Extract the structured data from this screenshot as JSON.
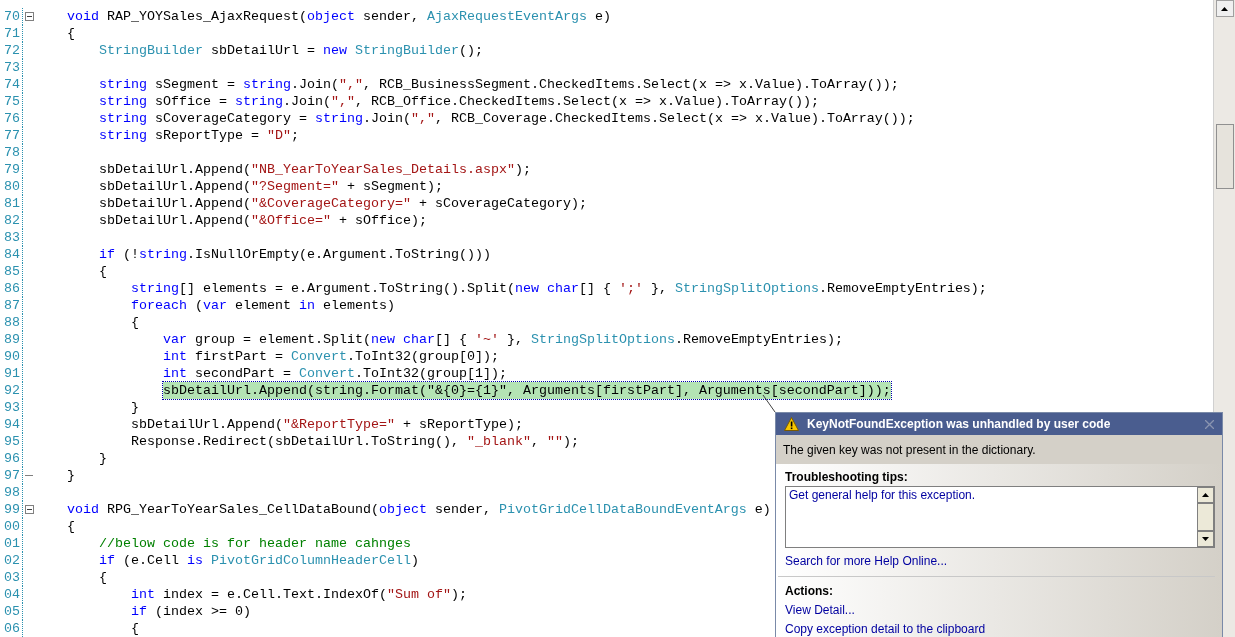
{
  "editor": {
    "lines": [
      {
        "number": "70",
        "kind": "fold_start",
        "selected": false,
        "tokens": [
          {
            "kind": "keyword",
            "text": "void"
          },
          {
            "kind": "plain",
            "text": " RAP_YOYSales_AjaxRequest("
          },
          {
            "kind": "keyword",
            "text": "object"
          },
          {
            "kind": "plain",
            "text": " sender, "
          },
          {
            "kind": "type",
            "text": "AjaxRequestEventArgs"
          },
          {
            "kind": "plain",
            "text": " e)"
          }
        ]
      },
      {
        "number": "71",
        "kind": "code",
        "selected": false,
        "tokens": [
          {
            "kind": "plain",
            "text": "{"
          }
        ]
      },
      {
        "number": "72",
        "kind": "code",
        "selected": false,
        "tokens": [
          {
            "kind": "type",
            "text": "StringBuilder"
          },
          {
            "kind": "plain",
            "text": " sbDetailUrl = "
          },
          {
            "kind": "keyword",
            "text": "new"
          },
          {
            "kind": "type",
            "text": " StringBuilder"
          },
          {
            "kind": "plain",
            "text": "();"
          }
        ]
      },
      {
        "number": "73",
        "kind": "code",
        "selected": false
      },
      {
        "number": "74",
        "kind": "code",
        "selected": false,
        "tokens": [
          {
            "kind": "keyword",
            "text": "string"
          },
          {
            "kind": "plain",
            "text": " sSegment = "
          },
          {
            "kind": "keyword",
            "text": "string"
          },
          {
            "kind": "plain",
            "text": ".Join("
          },
          {
            "kind": "string",
            "text": "\",\""
          },
          {
            "kind": "plain",
            "text": ", RCB_BusinessSegment.CheckedItems.Select(x => x.Value).ToArray());"
          }
        ]
      },
      {
        "number": "75",
        "kind": "code",
        "selected": false,
        "tokens": [
          {
            "kind": "keyword",
            "text": "string"
          },
          {
            "kind": "plain",
            "text": " sOffice = "
          },
          {
            "kind": "keyword",
            "text": "string"
          },
          {
            "kind": "plain",
            "text": ".Join("
          },
          {
            "kind": "string",
            "text": "\",\""
          },
          {
            "kind": "plain",
            "text": ", RCB_Office.CheckedItems.Select(x => x.Value).ToArray());"
          }
        ]
      },
      {
        "number": "76",
        "kind": "code",
        "selected": false,
        "tokens": [
          {
            "kind": "keyword",
            "text": "string"
          },
          {
            "kind": "plain",
            "text": " sCoverageCategory = "
          },
          {
            "kind": "keyword",
            "text": "string"
          },
          {
            "kind": "plain",
            "text": ".Join("
          },
          {
            "kind": "string",
            "text": "\",\""
          },
          {
            "kind": "plain",
            "text": ", RCB_Coverage.CheckedItems.Select(x => x.Value).ToArray());"
          }
        ]
      },
      {
        "number": "77",
        "kind": "code",
        "selected": false,
        "tokens": [
          {
            "kind": "keyword",
            "text": "string"
          },
          {
            "kind": "plain",
            "text": " sReportType = "
          },
          {
            "kind": "string",
            "text": "\"D\""
          },
          {
            "kind": "plain",
            "text": ";"
          }
        ]
      },
      {
        "number": "78",
        "kind": "code",
        "selected": false
      },
      {
        "number": "79",
        "kind": "code",
        "selected": false,
        "tokens": [
          {
            "kind": "plain",
            "text": "sbDetailUrl.Append("
          },
          {
            "kind": "string",
            "text": "\"NB_YearToYearSales_Details.aspx\""
          },
          {
            "kind": "plain",
            "text": ");"
          }
        ]
      },
      {
        "number": "80",
        "kind": "code",
        "selected": false,
        "tokens": [
          {
            "kind": "plain",
            "text": "sbDetailUrl.Append("
          },
          {
            "kind": "string",
            "text": "\"?Segment=\""
          },
          {
            "kind": "plain",
            "text": " + sSegment);"
          }
        ]
      },
      {
        "number": "81",
        "kind": "code",
        "selected": false,
        "tokens": [
          {
            "kind": "plain",
            "text": "sbDetailUrl.Append("
          },
          {
            "kind": "string",
            "text": "\"&CoverageCategory=\""
          },
          {
            "kind": "plain",
            "text": " + sCoverageCategory);"
          }
        ]
      },
      {
        "number": "82",
        "kind": "code",
        "selected": false,
        "tokens": [
          {
            "kind": "plain",
            "text": "sbDetailUrl.Append("
          },
          {
            "kind": "string",
            "text": "\"&Office=\""
          },
          {
            "kind": "plain",
            "text": " + sOffice);"
          }
        ]
      },
      {
        "number": "83",
        "kind": "code",
        "selected": false
      },
      {
        "number": "84",
        "kind": "code",
        "selected": false,
        "tokens": [
          {
            "kind": "keyword",
            "text": "if"
          },
          {
            "kind": "plain",
            "text": " (!"
          },
          {
            "kind": "keyword",
            "text": "string"
          },
          {
            "kind": "plain",
            "text": ".IsNullOrEmpty(e.Argument.ToString()))"
          }
        ]
      },
      {
        "number": "85",
        "kind": "code",
        "selected": false,
        "tokens": [
          {
            "kind": "plain",
            "text": "{"
          }
        ]
      },
      {
        "number": "86",
        "kind": "code",
        "selected": false,
        "tokens": [
          {
            "kind": "keyword",
            "text": "string"
          },
          {
            "kind": "plain",
            "text": "[] elements = e.Argument.ToString().Split("
          },
          {
            "kind": "keyword",
            "text": "new char"
          },
          {
            "kind": "plain",
            "text": "[] { "
          },
          {
            "kind": "string",
            "text": "';'"
          },
          {
            "kind": "plain",
            "text": " }, "
          },
          {
            "kind": "type",
            "text": "StringSplitOptions"
          },
          {
            "kind": "plain",
            "text": ".RemoveEmptyEntries);"
          }
        ]
      },
      {
        "number": "87",
        "kind": "code",
        "selected": false,
        "tokens": [
          {
            "kind": "keyword",
            "text": "foreach"
          },
          {
            "kind": "plain",
            "text": " ("
          },
          {
            "kind": "keyword",
            "text": "var"
          },
          {
            "kind": "plain",
            "text": " element "
          },
          {
            "kind": "keyword",
            "text": "in"
          },
          {
            "kind": "plain",
            "text": " elements)"
          }
        ]
      },
      {
        "number": "88",
        "kind": "code",
        "selected": false,
        "tokens": [
          {
            "kind": "plain",
            "text": "{"
          }
        ]
      },
      {
        "number": "89",
        "kind": "code",
        "selected": false,
        "tokens": [
          {
            "kind": "keyword",
            "text": "var"
          },
          {
            "kind": "plain",
            "text": " group = element.Split("
          },
          {
            "kind": "keyword",
            "text": "new char"
          },
          {
            "kind": "plain",
            "text": "[] { "
          },
          {
            "kind": "string",
            "text": "'~'"
          },
          {
            "kind": "plain",
            "text": " }, "
          },
          {
            "kind": "type",
            "text": "StringSplitOptions"
          },
          {
            "kind": "plain",
            "text": ".RemoveEmptyEntries);"
          }
        ]
      },
      {
        "number": "90",
        "kind": "code",
        "selected": false,
        "tokens": [
          {
            "kind": "keyword",
            "text": "int"
          },
          {
            "kind": "plain",
            "text": " firstPart = "
          },
          {
            "kind": "type",
            "text": "Convert"
          },
          {
            "kind": "plain",
            "text": ".ToInt32(group[0]);"
          }
        ]
      },
      {
        "number": "91",
        "kind": "code",
        "selected": false,
        "tokens": [
          {
            "kind": "keyword",
            "text": "int"
          },
          {
            "kind": "plain",
            "text": " secondPart = "
          },
          {
            "kind": "type",
            "text": "Convert"
          },
          {
            "kind": "plain",
            "text": ".ToInt32(group[1]);"
          }
        ]
      },
      {
        "number": "92",
        "kind": "code",
        "selected": true,
        "tokens": [
          {
            "kind": "plain",
            "text": "sbDetailUrl.Append(string.Format(\"&{0}={1}\", Arguments[firstPart], Arguments[secondPart]));"
          }
        ]
      },
      {
        "number": "93",
        "kind": "code",
        "selected": false,
        "tokens": [
          {
            "kind": "plain",
            "text": "}"
          }
        ]
      },
      {
        "number": "94",
        "kind": "code",
        "selected": false,
        "tokens": [
          {
            "kind": "plain",
            "text": "sbDetailUrl.Append("
          },
          {
            "kind": "string",
            "text": "\"&ReportType=\""
          },
          {
            "kind": "plain",
            "text": " + sReportType);"
          }
        ]
      },
      {
        "number": "95",
        "kind": "code",
        "selected": false,
        "tokens": [
          {
            "kind": "plain",
            "text": "Response.Redirect(sbDetailUrl.ToString(), "
          },
          {
            "kind": "string",
            "text": "\"_blank\""
          },
          {
            "kind": "plain",
            "text": ", "
          },
          {
            "kind": "string",
            "text": "\"\""
          },
          {
            "kind": "plain",
            "text": ");"
          }
        ]
      },
      {
        "number": "96",
        "kind": "code",
        "selected": false,
        "tokens": [
          {
            "kind": "plain",
            "text": "}"
          }
        ]
      },
      {
        "number": "97",
        "kind": "fold_end",
        "selected": false,
        "tokens": [
          {
            "kind": "plain",
            "text": "}"
          }
        ]
      },
      {
        "number": "98",
        "kind": "code",
        "selected": false
      },
      {
        "number": "99",
        "kind": "fold_start",
        "selected": false,
        "tokens": [
          {
            "kind": "keyword",
            "text": "void"
          },
          {
            "kind": "plain",
            "text": " RPG_YearToYearSales_CellDataBound("
          },
          {
            "kind": "keyword",
            "text": "object"
          },
          {
            "kind": "plain",
            "text": " sender, "
          },
          {
            "kind": "type",
            "text": "PivotGridCellDataBoundEventArgs"
          },
          {
            "kind": "plain",
            "text": " e)"
          }
        ]
      },
      {
        "number": "00",
        "kind": "code",
        "selected": false,
        "tokens": [
          {
            "kind": "plain",
            "text": "{"
          }
        ]
      },
      {
        "number": "01",
        "kind": "code",
        "selected": false,
        "tokens": [
          {
            "kind": "comment",
            "text": "//below code is for header name cahnges"
          }
        ]
      },
      {
        "number": "02",
        "kind": "code",
        "selected": false,
        "tokens": [
          {
            "kind": "keyword",
            "text": "if"
          },
          {
            "kind": "plain",
            "text": " (e.Cell "
          },
          {
            "kind": "keyword",
            "text": "is"
          },
          {
            "kind": "type",
            "text": " PivotGridColumnHeaderCell"
          },
          {
            "kind": "plain",
            "text": ")"
          }
        ]
      },
      {
        "number": "03",
        "kind": "code",
        "selected": false,
        "tokens": [
          {
            "kind": "plain",
            "text": "{"
          }
        ]
      },
      {
        "number": "04",
        "kind": "code",
        "selected": false,
        "tokens": [
          {
            "kind": "keyword",
            "text": "int"
          },
          {
            "kind": "plain",
            "text": " index = e.Cell.Text.IndexOf("
          },
          {
            "kind": "string",
            "text": "\"Sum of\""
          },
          {
            "kind": "plain",
            "text": ");"
          }
        ]
      },
      {
        "number": "05",
        "kind": "code",
        "selected": false,
        "tokens": [
          {
            "kind": "keyword",
            "text": "if"
          },
          {
            "kind": "plain",
            "text": " (index >= 0)"
          }
        ]
      },
      {
        "number": "06",
        "kind": "code",
        "selected": false,
        "tokens": [
          {
            "kind": "plain",
            "text": "{"
          }
        ]
      }
    ]
  },
  "exception_popup": {
    "title": "KeyNotFoundException was unhandled by user code",
    "message": "The given key was not present in the dictionary.",
    "tips_heading": "Troubleshooting tips:",
    "tips": [
      "Get general help for this exception."
    ],
    "help_link": "Search for more Help Online...",
    "actions_heading": "Actions:",
    "actions": [
      "View Detail...",
      "Copy exception detail to the clipboard"
    ]
  }
}
